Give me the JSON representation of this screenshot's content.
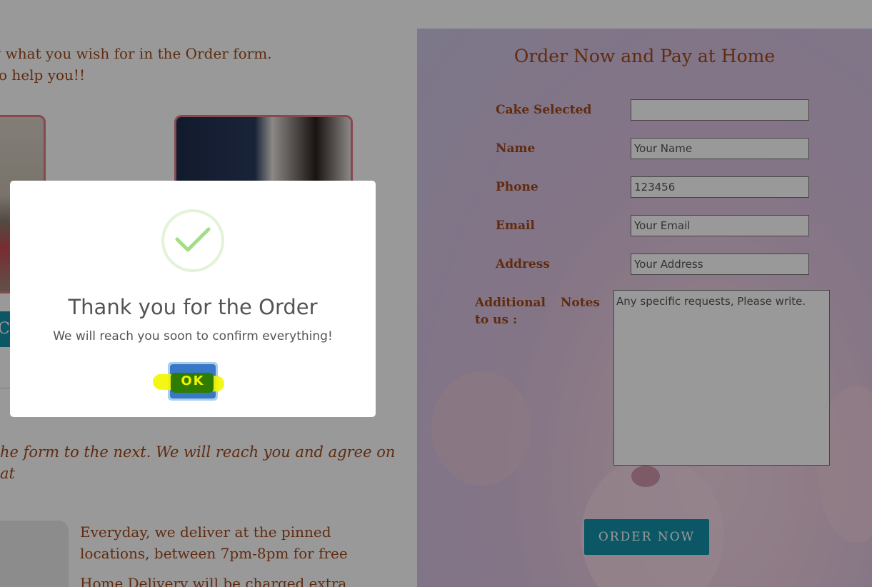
{
  "left": {
    "intro_line1": "y what you wish for in the Order form.",
    "intro_line2": " to help you!!",
    "partial_button_char": "C",
    "italic_line1": "he form to the next. We will reach you and agree on",
    "italic_line2": "at",
    "delivery_line1": "Everyday, we deliver at the pinned",
    "delivery_line2": "locations, between 7pm-8pm for free",
    "delivery_line3": "Home Delivery will be charged extra"
  },
  "form": {
    "title": "Order Now and Pay at Home",
    "cake_label": "Cake Selected",
    "cake_value": "",
    "name_label": "Name",
    "name_placeholder": "Your Name",
    "phone_label": "Phone",
    "phone_value": "123456",
    "email_label": "Email",
    "email_placeholder": "Your Email",
    "address_label": "Address",
    "address_placeholder": "Your Address",
    "notes_label": "Additional Notes to us :",
    "notes_placeholder": "Any specific requests, Please write.",
    "submit_label": "ORDER NOW"
  },
  "modal": {
    "title": "Thank you for the Order",
    "message": "We will reach you soon to confirm everything!",
    "ok_label": "OK"
  },
  "colors": {
    "accent_text": "#a0481a",
    "button_teal": "#1392a8",
    "confirm_blue": "#3778c7",
    "success_green": "#a5dc86",
    "highlight_yellow": "#f3f500"
  }
}
